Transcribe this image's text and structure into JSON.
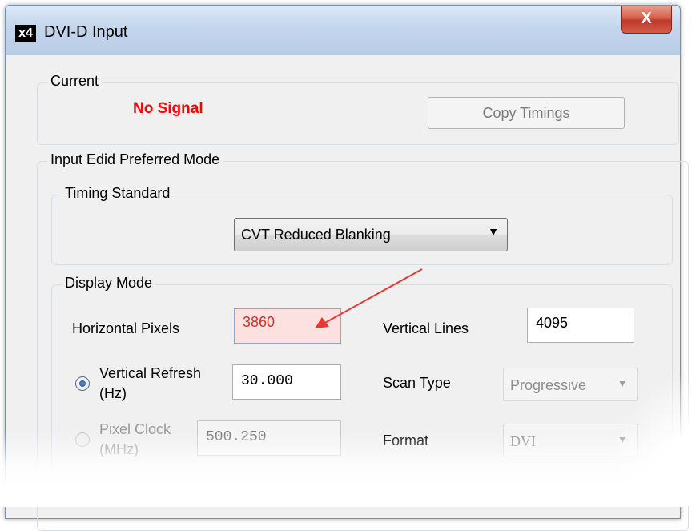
{
  "window": {
    "app_icon_label": "x4",
    "title": "DVI-D Input",
    "close_label": "X"
  },
  "current": {
    "legend": "Current",
    "status": "No Signal",
    "status_color": "#ff0000",
    "copy_button": "Copy Timings"
  },
  "preferred": {
    "legend": "Input Edid Preferred Mode",
    "timing": {
      "legend": "Timing Standard",
      "selected": "CVT Reduced Blanking"
    },
    "display": {
      "legend": "Display Mode",
      "horizontal_label": "Horizontal Pixels",
      "horizontal_value": "3860",
      "vertical_lines_label": "Vertical Lines",
      "vertical_lines_value": "4095",
      "refresh_label_1": "Vertical Refresh",
      "refresh_label_2": "(Hz)",
      "refresh_value": "30.000",
      "scan_type_label": "Scan Type",
      "scan_type_value": "Progressive",
      "pixel_clock_label_1": "Pixel Clock",
      "pixel_clock_label_2": "(MHz)",
      "pixel_clock_value": "500.250",
      "format_label": "Format",
      "format_value": "DVI"
    }
  },
  "annotation_color": "#e53935"
}
